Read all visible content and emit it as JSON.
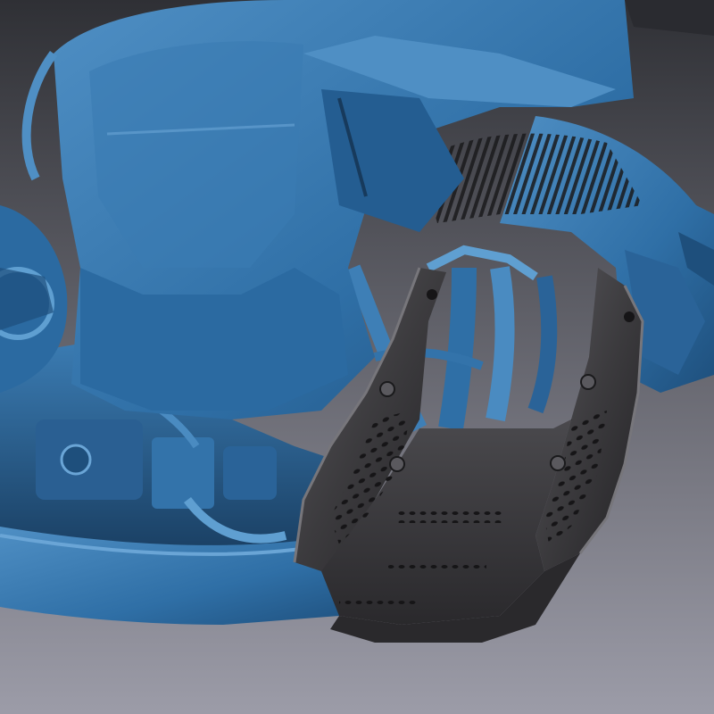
{
  "scene": {
    "subject": "3d-scan-motorcycle-skid-plate",
    "colors": {
      "background_top": "#2f3035",
      "background_bottom": "#9c9ca8",
      "scan_blue": "#2f6fa6",
      "scan_blue_dark": "#173a5c",
      "scan_blue_light": "#5f9fd1",
      "skid_plate": "#3c3b3e",
      "skid_plate_light": "#6e6d72",
      "skid_plate_dark": "#222124"
    }
  }
}
